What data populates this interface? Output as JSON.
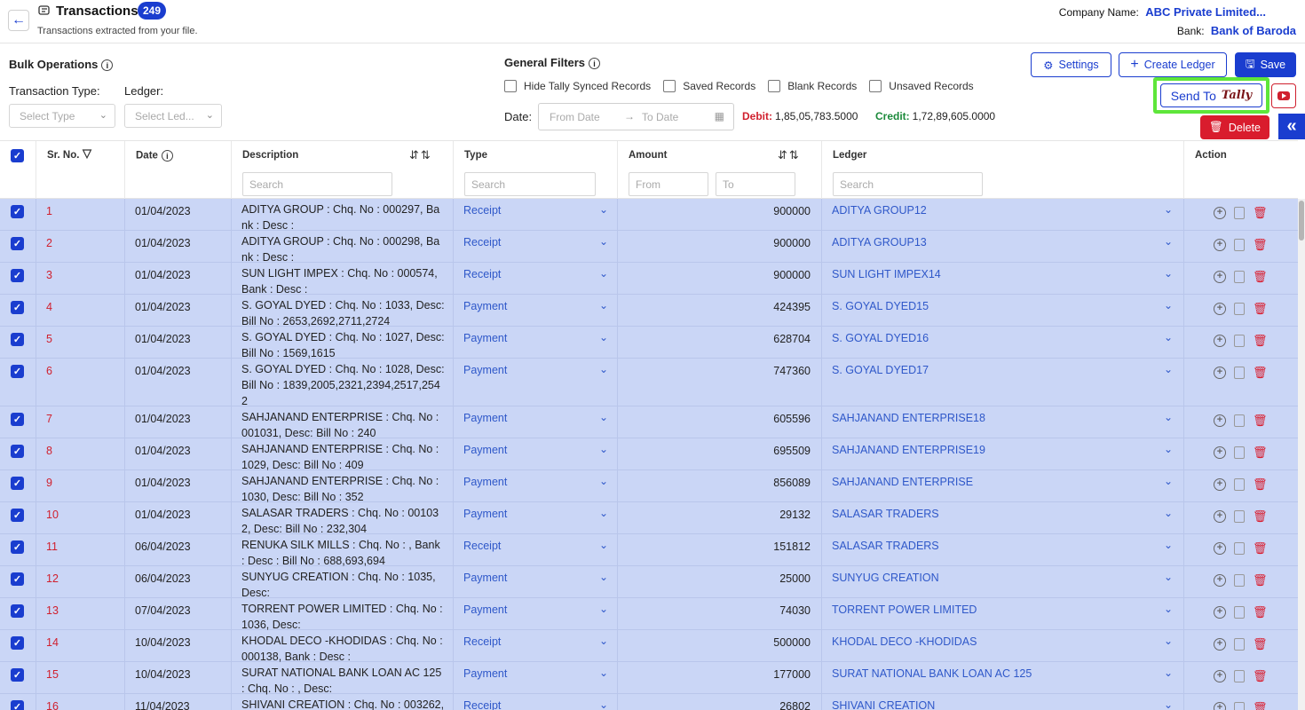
{
  "header": {
    "title": "Transactions",
    "count": "249",
    "subtitle": "Transactions extracted from your file.",
    "company_label": "Company Name:",
    "company_value": "ABC Private Limited...",
    "bank_label": "Bank:",
    "bank_value": "Bank of Baroda"
  },
  "bulk": {
    "title": "Bulk Operations",
    "type_label": "Transaction Type:",
    "ledger_label": "Ledger:",
    "type_placeholder": "Select Type",
    "ledger_placeholder": "Select Led..."
  },
  "filters": {
    "title": "General Filters",
    "options": [
      "Hide Tally Synced Records",
      "Saved Records",
      "Blank Records",
      "Unsaved Records"
    ],
    "date_label": "Date:",
    "from_placeholder": "From Date",
    "to_placeholder": "To Date",
    "debit_label": "Debit:",
    "debit_value": "1,85,05,783.5000",
    "credit_label": "Credit:",
    "credit_value": "1,72,89,605.0000"
  },
  "buttons": {
    "settings": "Settings",
    "create_ledger": "Create Ledger",
    "save": "Save",
    "send_to": "Send To",
    "tally": "Tally",
    "delete": "Delete"
  },
  "table": {
    "columns": {
      "sr": "Sr. No.",
      "date": "Date",
      "description": "Description",
      "type": "Type",
      "amount": "Amount",
      "ledger": "Ledger",
      "action": "Action"
    },
    "search_placeholder": "Search",
    "amount_from": "From",
    "amount_to": "To",
    "rows": [
      {
        "sr": "1",
        "date": "01/04/2023",
        "desc": "ADITYA GROUP : Chq. No : 000297, Bank : Desc :",
        "type": "Receipt",
        "amount": "900000",
        "ledger": "ADITYA GROUP12"
      },
      {
        "sr": "2",
        "date": "01/04/2023",
        "desc": "ADITYA GROUP : Chq. No : 000298, Bank : Desc :",
        "type": "Receipt",
        "amount": "900000",
        "ledger": "ADITYA GROUP13"
      },
      {
        "sr": "3",
        "date": "01/04/2023",
        "desc": "SUN LIGHT IMPEX : Chq. No : 000574, Bank : Desc :",
        "type": "Receipt",
        "amount": "900000",
        "ledger": "SUN LIGHT IMPEX14"
      },
      {
        "sr": "4",
        "date": "01/04/2023",
        "desc": "S. GOYAL DYED : Chq. No : 1033, Desc: Bill No : 2653,2692,2711,2724",
        "type": "Payment",
        "amount": "424395",
        "ledger": "S. GOYAL DYED15"
      },
      {
        "sr": "5",
        "date": "01/04/2023",
        "desc": "S. GOYAL DYED : Chq. No : 1027, Desc: Bill No : 1569,1615",
        "type": "Payment",
        "amount": "628704",
        "ledger": "S. GOYAL DYED16"
      },
      {
        "sr": "6",
        "date": "01/04/2023",
        "desc": "S. GOYAL DYED : Chq. No : 1028, Desc: Bill No : 1839,2005,2321,2394,2517,2542",
        "type": "Payment",
        "amount": "747360",
        "ledger": "S. GOYAL DYED17"
      },
      {
        "sr": "7",
        "date": "01/04/2023",
        "desc": "SAHJANAND ENTERPRISE : Chq. No : 001031, Desc: Bill No : 240",
        "type": "Payment",
        "amount": "605596",
        "ledger": "SAHJANAND ENTERPRISE18"
      },
      {
        "sr": "8",
        "date": "01/04/2023",
        "desc": "SAHJANAND ENTERPRISE : Chq. No : 1029, Desc: Bill No : 409",
        "type": "Payment",
        "amount": "695509",
        "ledger": "SAHJANAND ENTERPRISE19"
      },
      {
        "sr": "9",
        "date": "01/04/2023",
        "desc": "SAHJANAND ENTERPRISE : Chq. No : 1030, Desc: Bill No : 352",
        "type": "Payment",
        "amount": "856089",
        "ledger": "SAHJANAND ENTERPRISE"
      },
      {
        "sr": "10",
        "date": "01/04/2023",
        "desc": "SALASAR TRADERS : Chq. No : 001032, Desc: Bill No : 232,304",
        "type": "Payment",
        "amount": "29132",
        "ledger": "SALASAR TRADERS"
      },
      {
        "sr": "11",
        "date": "06/04/2023",
        "desc": "RENUKA SILK MILLS : Chq. No : , Bank : Desc : Bill No : 688,693,694",
        "type": "Receipt",
        "amount": "151812",
        "ledger": "SALASAR TRADERS"
      },
      {
        "sr": "12",
        "date": "06/04/2023",
        "desc": "SUNYUG CREATION : Chq. No : 1035, Desc:",
        "type": "Payment",
        "amount": "25000",
        "ledger": "SUNYUG CREATION"
      },
      {
        "sr": "13",
        "date": "07/04/2023",
        "desc": "TORRENT POWER LIMITED : Chq. No : 1036, Desc:",
        "type": "Payment",
        "amount": "74030",
        "ledger": "TORRENT POWER LIMITED"
      },
      {
        "sr": "14",
        "date": "10/04/2023",
        "desc": "KHODAL DECO -KHODIDAS : Chq. No : 000138, Bank : Desc :",
        "type": "Receipt",
        "amount": "500000",
        "ledger": "KHODAL DECO -KHODIDAS"
      },
      {
        "sr": "15",
        "date": "10/04/2023",
        "desc": "SURAT NATIONAL BANK LOAN AC 125 : Chq. No : , Desc:",
        "type": "Payment",
        "amount": "177000",
        "ledger": "SURAT NATIONAL BANK LOAN AC 125"
      },
      {
        "sr": "16",
        "date": "11/04/2023",
        "desc": "SHIVANI CREATION : Chq. No : 003262,",
        "type": "Receipt",
        "amount": "26802",
        "ledger": "SHIVANI CREATION"
      }
    ]
  }
}
